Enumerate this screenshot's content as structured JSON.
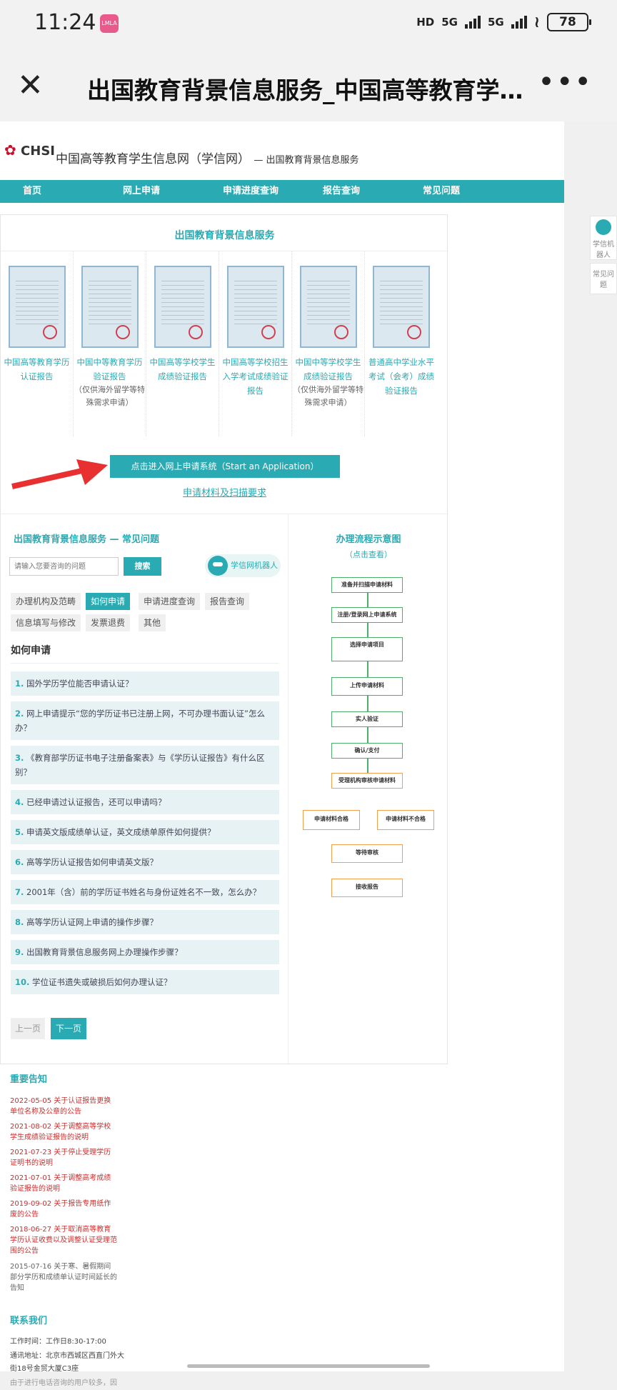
{
  "status_bar": {
    "time": "11:24",
    "app_badge": "LMLA",
    "hd": "HD",
    "net1": "5G",
    "net2": "5G",
    "battery": "78"
  },
  "top_bar": {
    "title": "出国教育背景信息服务_中国高等教育学生信息网（学信网）"
  },
  "header": {
    "logo_text": "CHSI",
    "site_title": "中国高等教育学生信息网（学信网）",
    "subtitle": "— 出国教育背景信息服务"
  },
  "nav": [
    "首页",
    "网上申请",
    "申请进度查询",
    "报告查询",
    "常见问题"
  ],
  "section_title": "出国教育背景信息服务",
  "cards": [
    {
      "label": "中国高等教育学历认证报告",
      "note": ""
    },
    {
      "label": "中国中等教育学历验证报告",
      "note": "（仅供海外留学等特殊需求申请）"
    },
    {
      "label": "中国高等学校学生成绩验证报告",
      "note": ""
    },
    {
      "label": "中国高等学校招生入学考试成绩验证报告",
      "note": ""
    },
    {
      "label": "中国中等学校学生成绩验证报告",
      "note": "（仅供海外留学等特殊需求申请）"
    },
    {
      "label": "普通高中学业水平考试（会考）成绩验证报告",
      "note": ""
    }
  ],
  "apply_button": "点击进入网上申请系统（Start an Application）",
  "apply_link": "申请材料及扫描要求",
  "faq": {
    "title": "出国教育背景信息服务 — 常见问题",
    "search_placeholder": "请输入您要咨询的问题",
    "search_button": "搜索",
    "robot_label": "学信网机器人",
    "categories": [
      "办理机构及范畴",
      "如何申请",
      "申请进度查询",
      "报告查询",
      "信息填写与修改",
      "发票退费",
      "其他"
    ],
    "current_category": "如何申请",
    "questions": [
      {
        "n": "1.",
        "text": "国外学历学位能否申请认证？"
      },
      {
        "n": "2.",
        "text": "网上申请提示“您的学历证书已注册上网，不可办理书面认证”怎么办？"
      },
      {
        "n": "3.",
        "text": "《教育部学历证书电子注册备案表》与《学历认证报告》有什么区别？"
      },
      {
        "n": "4.",
        "text": "已经申请过认证报告，还可以申请吗？"
      },
      {
        "n": "5.",
        "text": "申请英文版成绩单认证，英文成绩单原件如何提供？"
      },
      {
        "n": "6.",
        "text": "高等学历认证报告如何申请英文版？"
      },
      {
        "n": "7.",
        "text": "2001年（含）前的学历证书姓名与身份证姓名不一致，怎么办？"
      },
      {
        "n": "8.",
        "text": "高等学历认证网上申请的操作步骤？"
      },
      {
        "n": "9.",
        "text": "出国教育背景信息服务网上办理操作步骤？"
      },
      {
        "n": "10.",
        "text": "学位证书遗失或破损后如何办理认证？"
      }
    ],
    "prev": "上一页",
    "next": "下一页"
  },
  "flow": {
    "title": "办理流程示意图",
    "subtitle": "（点击查看）",
    "steps": [
      "准备并扫描申请材料",
      "注册/登录网上申请系统",
      "选择申请项目",
      "上传申请材料",
      "实人验证",
      "确认/支付",
      "受理机构审核申请材料",
      "申请材料合格",
      "申请材料不合格",
      "等待审核",
      "接收报告"
    ]
  },
  "notices": {
    "title": "重要告知",
    "items": [
      "2022-05-05 关于认证报告更换单位名称及公章的公告",
      "2021-08-02 关于调整高等学校学生成绩验证报告的说明",
      "2021-07-23 关于停止受理学历证明书的说明",
      "2021-07-01 关于调整高考成绩验证报告的说明",
      "2019-09-02 关于报告专用纸作废的公告",
      "2018-06-27 关于取消高等教育学历认证收费以及调整认证受理范围的公告",
      "2015-07-16 关于寒、暑假期间部分学历和成绩单认证时间延长的告知"
    ]
  },
  "contact": {
    "title": "联系我们",
    "hours": "工作时间：工作日8:30-17:00",
    "address": "通讯地址：北京市西城区西直门外大街18号金贸大厦C3座",
    "note": "由于进行电话咨询的用户较多，因"
  },
  "float": {
    "robot": "学信机器人",
    "faq": "常见问题"
  }
}
